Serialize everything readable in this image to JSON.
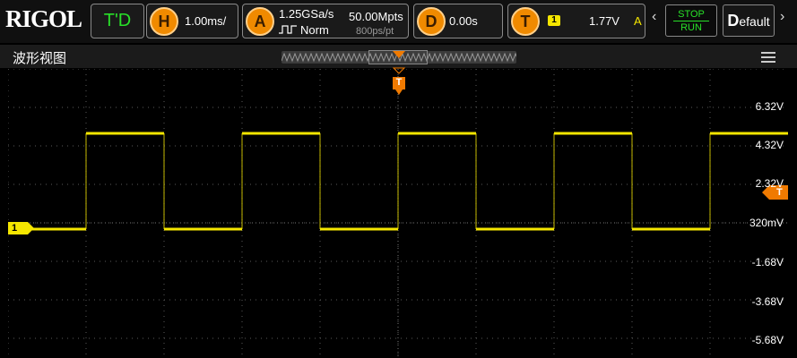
{
  "brand": {
    "logo": "RIGOL"
  },
  "toolbar": {
    "trigger_mode": "T'D",
    "horizontal": {
      "label": "H",
      "value": "1.00ms/"
    },
    "acquire": {
      "label": "A",
      "sample_rate": "1.25GSa/s",
      "mode": "Norm",
      "memory_depth": "50.00Mpts",
      "resolution": "800ps/pt"
    },
    "delay": {
      "label": "D",
      "value": "0.00s"
    },
    "trigger": {
      "label": "T",
      "channel": "1",
      "level": "1.77V",
      "type": "A"
    },
    "run_state": {
      "top": "STOP",
      "bottom": "RUN"
    },
    "default": {
      "first": "D",
      "rest": "efault"
    },
    "prev_arrow": "‹",
    "next_arrow": "›"
  },
  "panel": {
    "title": "波形视图"
  },
  "channel": {
    "number": "1",
    "color": "#f5e600"
  },
  "trigger_marker": {
    "label": "T",
    "color": "#f07a00"
  },
  "scale_labels": [
    "6.32V",
    "4.32V",
    "2.32V",
    "320mV",
    "-1.68V",
    "-3.68V",
    "-5.68V"
  ],
  "waveform": {
    "type": "square",
    "high_level": "4.32V",
    "low_level": "320mV"
  },
  "colors": {
    "accent": "#f08a00",
    "status_green": "#28e028",
    "trace": "#f5e600"
  }
}
